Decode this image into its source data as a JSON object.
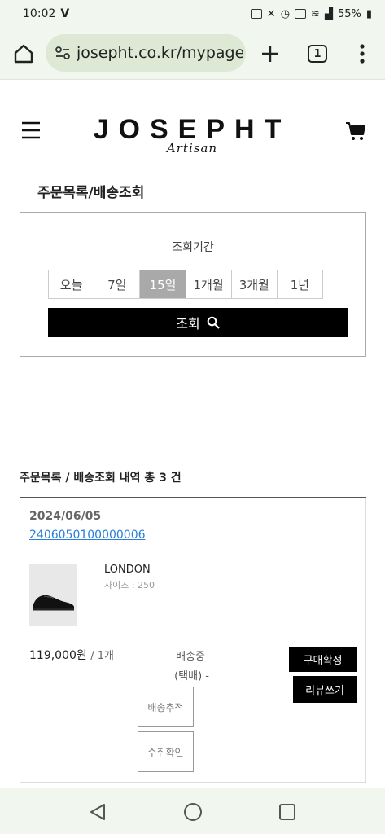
{
  "status_bar": {
    "time": "10:02",
    "battery": "55%"
  },
  "browser": {
    "url": "josepht.co.kr/mypage/",
    "tab_count": "1"
  },
  "header": {
    "logo_main": "JOSEPHT",
    "logo_sub": "Artisan"
  },
  "page": {
    "title": "주문목록/배송조회",
    "period_label": "조회기간",
    "periods": [
      "오늘",
      "7일",
      "15일",
      "1개월",
      "3개월",
      "1년"
    ],
    "selected_period": "15일",
    "search_button": "조회"
  },
  "list": {
    "title": "주문목록 / 배송조회 내역 총 3 건",
    "orders": [
      {
        "date": "2024/06/05",
        "order_number": "2406050100000006",
        "product_name": "LONDON",
        "option": "사이즈 : 250",
        "price": "119,000원",
        "quantity": "/ 1개",
        "status": "배송중",
        "ship_method": "(택배) -",
        "track_button": "배송추적",
        "receive_button": "수취확인",
        "confirm_button": "구매확정",
        "review_button": "리뷰쓰기"
      }
    ]
  },
  "colors": {
    "accent_link": "#2a7ed8",
    "selected_period_bg": "#a9a9a9",
    "chrome_bg": "#f1f7ee"
  }
}
